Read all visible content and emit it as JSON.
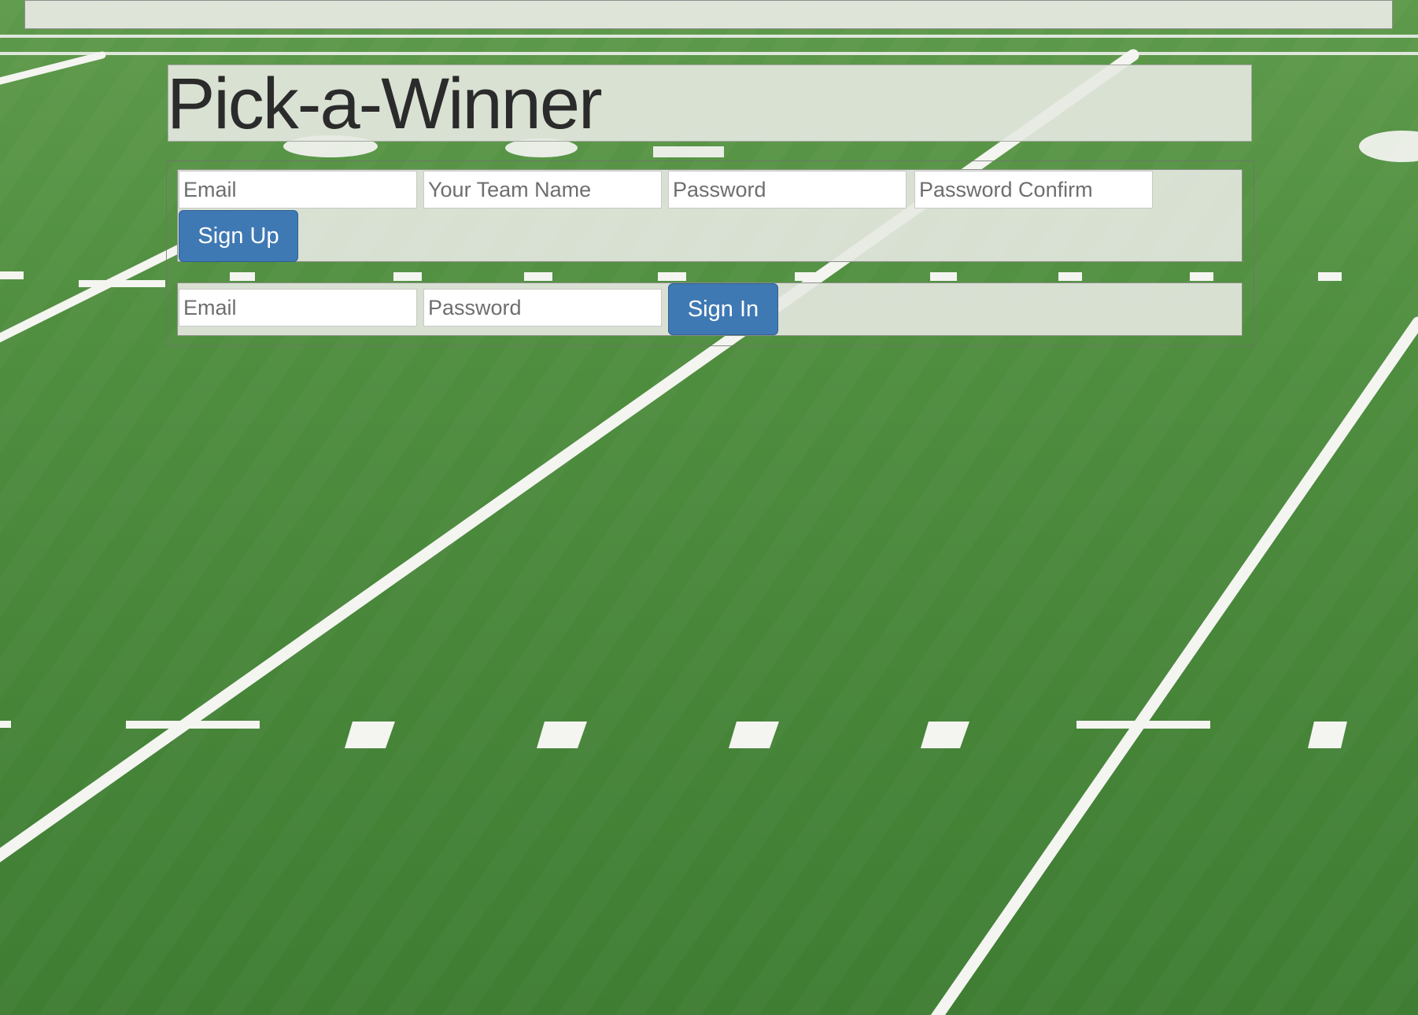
{
  "colors": {
    "turf_green": "#4c8a3c",
    "field_line_white": "#ffffff",
    "panel_background": "#e7e9e2",
    "button_blue": "#3f79b4",
    "title_text": "#2b2b2b"
  },
  "header": {
    "title": "Pick-a-Winner"
  },
  "signup": {
    "email_placeholder": "Email",
    "team_name_placeholder": "Your Team Name",
    "password_placeholder": "Password",
    "password_confirm_placeholder": "Password Confirm",
    "submit_label": "Sign Up"
  },
  "signin": {
    "email_placeholder": "Email",
    "password_placeholder": "Password",
    "submit_label": "Sign In"
  }
}
